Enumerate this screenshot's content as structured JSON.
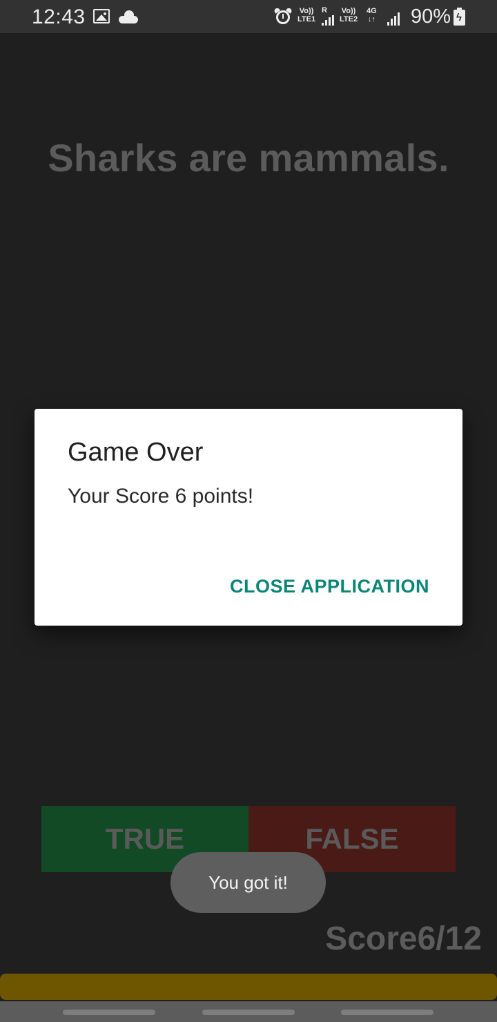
{
  "status_bar": {
    "time": "12:43",
    "sim1": {
      "volte": "Vo))",
      "network": "LTE1",
      "roaming": "R"
    },
    "sim2": {
      "volte": "Vo))",
      "network": "LTE2",
      "data_type": "4G"
    },
    "battery_percent": "90%",
    "icons": [
      "gallery-icon",
      "cloud-icon",
      "alarm-icon",
      "signal-icon",
      "battery-charging-icon"
    ]
  },
  "quiz": {
    "question": "Sharks are mammals.",
    "true_label": "TRUE",
    "false_label": "FALSE",
    "score_label": "Score6/12",
    "progress": 1.0
  },
  "dialog": {
    "title": "Game Over",
    "message": "Your Score 6 points!",
    "button_label": "CLOSE APPLICATION"
  },
  "toast": {
    "message": "You got it!"
  },
  "colors": {
    "background": "#1f1f1f",
    "true_button": "#124a26",
    "false_button": "#4a1a16",
    "progress_fill": "#6e5600",
    "dialog_accent": "#0b8576"
  }
}
